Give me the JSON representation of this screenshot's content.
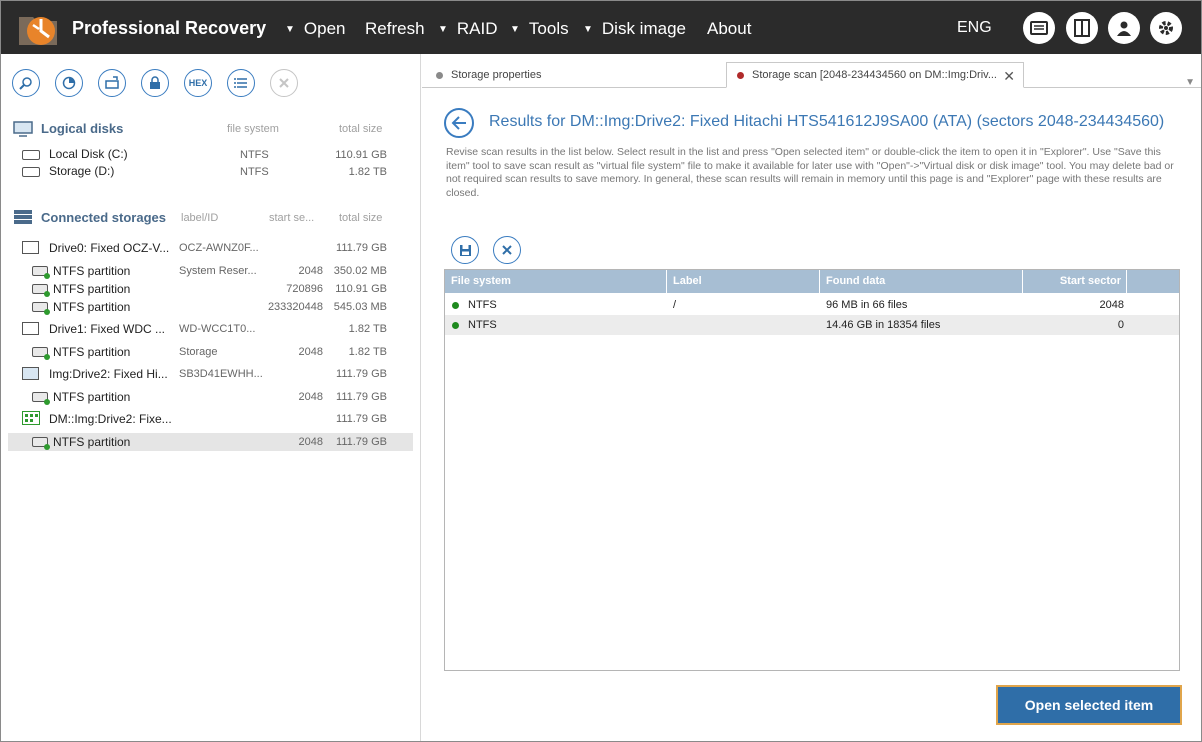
{
  "app": {
    "title": "Professional Recovery"
  },
  "menu": [
    {
      "label": "Open",
      "caret": true
    },
    {
      "label": "Refresh",
      "caret": false
    },
    {
      "label": "RAID",
      "caret": true
    },
    {
      "label": "Tools",
      "caret": true
    },
    {
      "label": "Disk image",
      "caret": true
    },
    {
      "label": "About",
      "caret": false
    }
  ],
  "lang": "ENG",
  "toolbar_icons": [
    "hex-label-icon"
  ],
  "hex_label": "HEX",
  "logical": {
    "title": "Logical disks",
    "col_fs": "file system",
    "col_size": "total size",
    "items": [
      {
        "name": "Local Disk (C:)",
        "fs": "NTFS",
        "size": "110.91 GB"
      },
      {
        "name": "Storage (D:)",
        "fs": "NTFS",
        "size": "1.82 TB"
      }
    ]
  },
  "storages": {
    "title": "Connected storages",
    "col_label": "label/ID",
    "col_start": "start se...",
    "col_size": "total size",
    "items": [
      {
        "name": "Drive0: Fixed OCZ-V...",
        "label": "OCZ-AWNZ0F...",
        "start": "",
        "size": "111.79 GB",
        "level": 0
      },
      {
        "name": "NTFS partition",
        "label": "System Reser...",
        "start": "2048",
        "size": "350.02 MB",
        "level": 1
      },
      {
        "name": "NTFS partition",
        "label": "",
        "start": "720896",
        "size": "110.91 GB",
        "level": 1
      },
      {
        "name": "NTFS partition",
        "label": "",
        "start": "233320448",
        "size": "545.03 MB",
        "level": 1
      },
      {
        "name": "Drive1: Fixed WDC ...",
        "label": "WD-WCC1T0...",
        "start": "",
        "size": "1.82 TB",
        "level": 0
      },
      {
        "name": "NTFS partition",
        "label": "Storage",
        "start": "2048",
        "size": "1.82 TB",
        "level": 1
      },
      {
        "name": "Img:Drive2: Fixed Hi...",
        "label": "SB3D41EWHH...",
        "start": "",
        "size": "111.79 GB",
        "level": 0
      },
      {
        "name": "NTFS partition",
        "label": "",
        "start": "2048",
        "size": "111.79 GB",
        "level": 1
      },
      {
        "name": "DM::Img:Drive2: Fixe...",
        "label": "",
        "start": "",
        "size": "111.79 GB",
        "level": 0
      },
      {
        "name": "NTFS partition",
        "label": "",
        "start": "2048",
        "size": "111.79 GB",
        "level": 1
      }
    ]
  },
  "tabs": [
    {
      "label": "Storage properties",
      "dot_color": "#8a8a8a"
    },
    {
      "label": "Storage scan [2048-234434560 on DM::Img:Driv...",
      "dot_color": "#b02a2a"
    }
  ],
  "results": {
    "title": "Results for DM::Img:Drive2: Fixed Hitachi HTS541612J9SA00 (ATA) (sectors 2048-234434560)",
    "description": "Revise scan results in the list below. Select result in the list and press \"Open selected item\" or double-click the item to open it in \"Explorer\". Use \"Save this item\" tool to save scan result as \"virtual file system\" file to make it available for later use with \"Open\"->\"Virtual disk or disk image\" tool. You may delete bad or not required scan results to save memory. In general, these scan results will remain in memory until this page is and \"Explorer\" page with these results are closed.",
    "columns": [
      "File system",
      "Label",
      "Found data",
      "Start sector"
    ],
    "rows": [
      {
        "fs": "NTFS",
        "label": "/",
        "found": "96 MB in 66 files",
        "start": "2048"
      },
      {
        "fs": "NTFS",
        "label": "",
        "found": "14.46 GB in 18354 files",
        "start": "0"
      }
    ],
    "open_button": "Open selected item"
  },
  "colors": {
    "titlebar": "#2b2b2b",
    "accent": "#3c78b4",
    "button": "#2f6ea8",
    "button_border": "#e0a54b",
    "grid_header": "#a7bed3",
    "status_ok": "#1e8a1e"
  }
}
